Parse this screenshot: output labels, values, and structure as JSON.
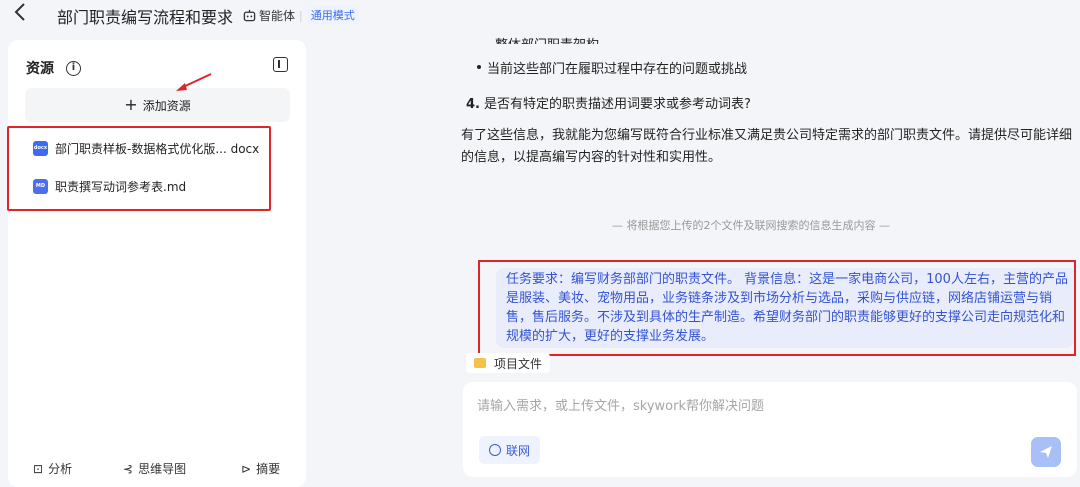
{
  "header": {
    "back_icon": "chevron-left-icon",
    "title": "部门职责编写流程和要求",
    "agent_label": "智能体",
    "separator": "|",
    "mode_label": "通用模式"
  },
  "sidebar": {
    "title": "资源",
    "info_icon": "i",
    "add_label": "添加资源",
    "files": [
      {
        "icon_text": "docx",
        "name": "部门职责样板-数据格式优化版... docx"
      },
      {
        "icon_text": "MD",
        "name": "职责撰写动词参考表.md"
      }
    ],
    "tools": [
      {
        "icon": "⊡",
        "label": "分析"
      },
      {
        "icon": "⊰",
        "label": "思维导图"
      },
      {
        "icon": "⊳",
        "label": "摘要"
      }
    ]
  },
  "chat": {
    "cut_line": "整体部门职责架构",
    "bullet": "当前这些部门在履职过程中存在的问题或挑战",
    "q4_num": "4.",
    "q4_text": "是否有特定的职责描述用词要求或参考动词表?",
    "paragraph": "有了这些信息，我就能为您编写既符合行业标准又满足贵公司特定需求的部门职责文件。请提供尽可能详细的信息，以提高编写内容的针对性和实用性。",
    "divider_note": "— 将根据您上传的2个文件及联网搜索的信息生成内容 —",
    "task_text": "任务要求：编写财务部部门的职责文件。 背景信息：这是一家电商公司，100人左右，主营的产品是服装、美妆、宠物用品，业务链条涉及到市场分析与选品，采购与供应链，网络店铺运营与销售，售后服务。不涉及到具体的生产制造。希望财务部门的职责能够更好的支撑公司走向规范化和规模的扩大，更好的支撑业务发展。",
    "project_chip": "项目文件"
  },
  "input": {
    "placeholder": "请输入需求，或上传文件，skywork帮你解决问题",
    "value": "",
    "web_label": "联网"
  },
  "colors": {
    "accent": "#3a6cf0",
    "highlight_border": "#e0252a",
    "task_text": "#3454d1",
    "task_bg": "#e9ecfb"
  }
}
